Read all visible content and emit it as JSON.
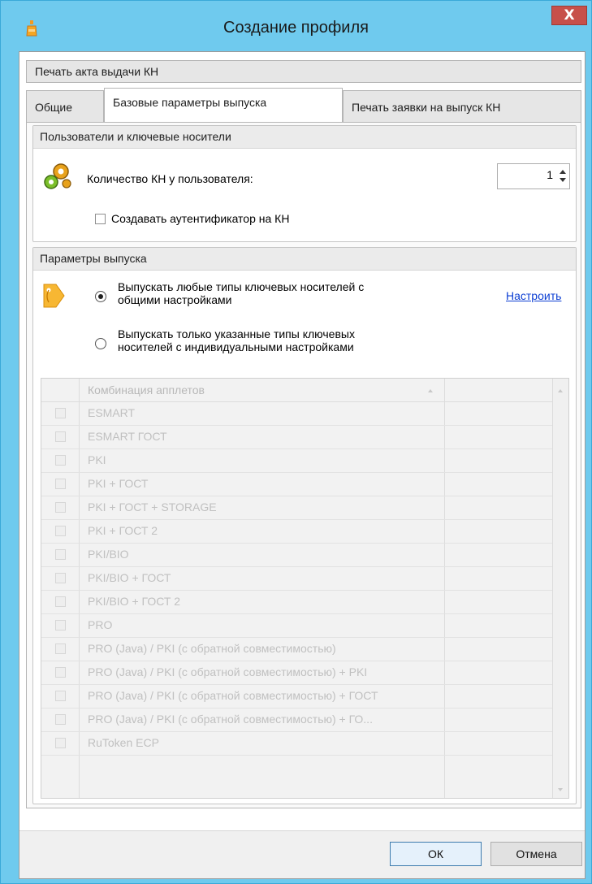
{
  "window": {
    "title": "Создание профиля",
    "close_label": "X"
  },
  "tabs": {
    "row1": [
      {
        "label": "Печать акта выдачи КН"
      }
    ],
    "row2": [
      {
        "label": "Общие"
      },
      {
        "label": "Базовые параметры выпуска",
        "active": true
      },
      {
        "label": "Печать заявки на выпуск КН"
      }
    ]
  },
  "users_group": {
    "title": "Пользователи и ключевые носители",
    "count_label": "Количество КН у пользователя:",
    "count_value": "1",
    "auth_checkbox_label": "Создавать аутентификатор на КН",
    "auth_checked": false
  },
  "release_group": {
    "title": "Параметры выпуска",
    "option_any_line1": "Выпускать любые типы ключевых носителей с",
    "option_any_line2": "общими настройками",
    "option_specific_line1": "Выпускать только указанные типы ключевых",
    "option_specific_line2": "носителей с индивидуальными настройками",
    "selected": "any",
    "configure_link": "Настроить"
  },
  "applets_grid": {
    "header": "Комбинация апплетов",
    "rows": [
      "ESMART",
      "ESMART ГОСТ",
      "PKI",
      "PKI + ГОСТ",
      "PKI + ГОСТ + STORAGE",
      "PKI + ГОСТ 2",
      "PKI/BIO",
      "PKI/BIO + ГОСТ",
      "PKI/BIO + ГОСТ 2",
      "PRO",
      "PRO (Java) / PKI (с обратной совместимостью)",
      "PRO (Java) / PKI (с обратной совместимостью) + PKI",
      "PRO (Java) / PKI (с обратной совместимостью) + ГОСТ",
      "PRO (Java) / PKI (с обратной совместимостью) + ГО...",
      "RuToken ЕСР"
    ]
  },
  "buttons": {
    "ok": "ОК",
    "cancel": "Отмена"
  },
  "colors": {
    "titlebar": "#6fcaee",
    "close": "#c7504a",
    "link": "#0b3ed3"
  }
}
